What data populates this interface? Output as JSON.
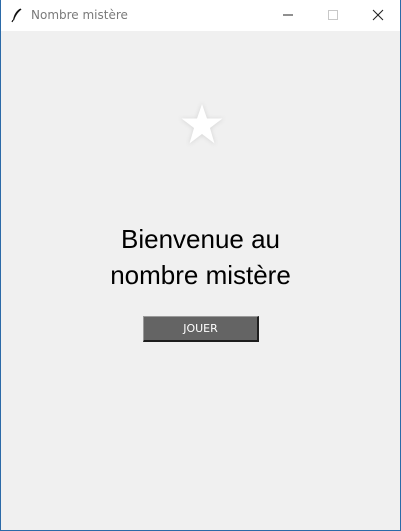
{
  "window": {
    "title": "Nombre mistère",
    "icons": {
      "app": "feather-icon",
      "minimize": "minimize-icon",
      "maximize": "maximize-icon",
      "close": "close-icon"
    }
  },
  "main": {
    "logo_icon": "star-icon",
    "welcome_line1": "Bienvenue au",
    "welcome_line2": "nombre mistère",
    "play_button_label": "JOUER"
  },
  "colors": {
    "background": "#f0f0f0",
    "button_background": "#646464",
    "button_text": "#ffffff",
    "window_border": "#2b6aa8"
  }
}
